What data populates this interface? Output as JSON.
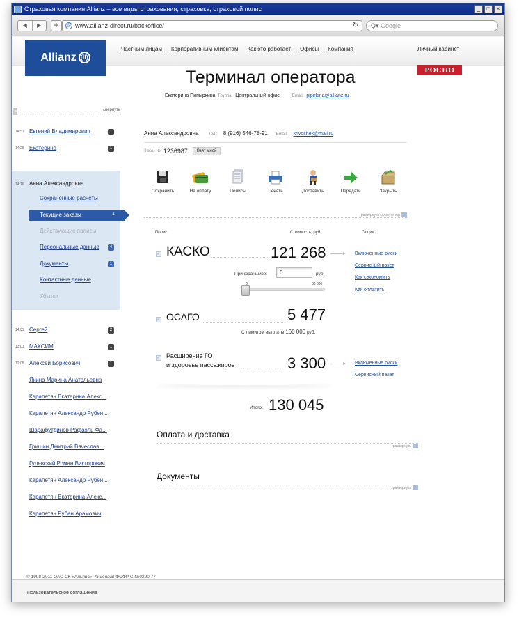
{
  "window": {
    "title": "Страховая компания Allianz – все виды страхования, страховка, страховой полис",
    "btns": [
      "_",
      "□",
      "×"
    ]
  },
  "browser": {
    "url": "www.allianz-direct.ru/backoffice/",
    "search_placeholder": "Google",
    "back": "◀",
    "fwd": "▶",
    "add": "+",
    "reload": "↻",
    "globe": "@",
    "search_icon": "Q▾"
  },
  "site": {
    "logo": "Allianz",
    "logo_mark": "(ll)",
    "nav": [
      "Частным лицам",
      "Корпоративным клиентам",
      "Как это работает",
      "Офисы",
      "Компания"
    ],
    "cabinet": "Личный кабинет",
    "partner": "РОСНО",
    "title": "Терминал оператора",
    "operator": {
      "name": "Екатерина Пипыркина",
      "group_label": "Группа:",
      "group": "Центральный офис",
      "email_label": "Email:",
      "email": "pipirkina@allianz.ru"
    }
  },
  "sidebar": {
    "collapse": "свернуть",
    "collapse_icon": "◂",
    "top_clients": [
      {
        "time": "14:51",
        "name": "Евгений Владимирович",
        "count": "1"
      },
      {
        "time": "14:28",
        "name": "Екатерина",
        "count": "1"
      }
    ],
    "active": {
      "time": "14:16",
      "name": "Анна Александровна",
      "items": [
        {
          "label": "Сохраненные расчеты"
        },
        {
          "label": "Текущие заказы",
          "count": "1"
        },
        {
          "label": "Действующие полисы"
        },
        {
          "label": "Персональные данные",
          "count": "4"
        },
        {
          "label": "Документы",
          "count": "1"
        },
        {
          "label": "Контактные данные"
        },
        {
          "label": "Убытки"
        }
      ]
    },
    "clients": [
      {
        "time": "14:01",
        "name": "Сергей",
        "count": "2"
      },
      {
        "time": "13:01",
        "name": "МАКСИМ",
        "count": "1"
      },
      {
        "time": "12:08",
        "name": "Алексей Борисович",
        "count": "1"
      },
      {
        "name": "Якина Марина Анатольевна"
      },
      {
        "name": "Карапетян Екатерина Алекс..."
      },
      {
        "name": "Карапетян Александр Рубен..."
      },
      {
        "name": "Шарафутдинов Рафаэль Фа..."
      },
      {
        "name": "Гришин Дмитрий Вячеслав..."
      },
      {
        "name": "Гулевский Роман Викторович"
      },
      {
        "name": "Карапетян Александр Рубен..."
      },
      {
        "name": "Карапетян Екатерина Алекс..."
      },
      {
        "name": "Карапетян Рубен Арамович"
      }
    ]
  },
  "client": {
    "name": "Анна Александровна",
    "phone_label": "Тел.:",
    "phone": "8 (916) 546-78-91",
    "email_label": "Email:",
    "email": "krivoshek@mail.ru"
  },
  "order": {
    "label": "Заказ №",
    "number": "1236987",
    "take": "Взят мной"
  },
  "actions": [
    {
      "label": "Сохранить",
      "icon": "floppy-icon"
    },
    {
      "label": "На оплату",
      "icon": "cards-icon"
    },
    {
      "label": "Полисы",
      "icon": "documents-icon"
    },
    {
      "label": "Печать",
      "icon": "printer-icon"
    },
    {
      "label": "Доставить",
      "icon": "courier-icon"
    },
    {
      "label": "Передать",
      "icon": "green-arrow-icon"
    },
    {
      "label": "Закрыть",
      "icon": "box-icon"
    }
  ],
  "calc_toggle": "развернуть калькулятор",
  "table": {
    "col_policy": "Полис",
    "col_price": "Стоимость, руб",
    "col_options": "Опции"
  },
  "policies": {
    "kasko": {
      "name": "КАСКО",
      "price": "121 268",
      "franchise_label": "При франшизе:",
      "franchise_value": "0",
      "franchise_unit": "руб.",
      "slider_min": "0",
      "slider_max": "30 000",
      "slider_value": 0,
      "options": [
        "Включенные риски",
        "Сервисный пакет",
        "Как сэкономить",
        "Как оплатить"
      ]
    },
    "osago": {
      "name": "ОСАГО",
      "price": "5 477",
      "limit_label": "С лимитом выплаты",
      "limit": "160 000",
      "limit_unit": "руб."
    },
    "go": {
      "name1": "Расширение ГО",
      "name2": "и здоровье пассажиров",
      "price": "3 300",
      "options": [
        "Включенные риски",
        "Сервисный пакет"
      ]
    }
  },
  "check": "✓",
  "total": {
    "label": "Итого:",
    "value": "130 045"
  },
  "sections": [
    {
      "title": "Оплата и доставка",
      "toggle": "развернуть"
    },
    {
      "title": "Документы",
      "toggle": "развернуть"
    }
  ],
  "footer": {
    "copyright": "© 1998-2011 ОАО СК «Альянс», лицензия ФСФР С №0290 77",
    "agreement": "Пользовательское соглашение"
  }
}
